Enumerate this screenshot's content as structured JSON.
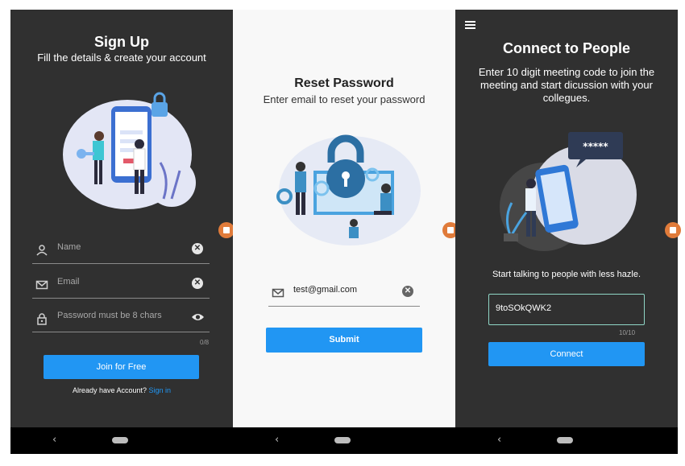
{
  "signup": {
    "title": "Sign Up",
    "subtitle": "Fill the details & create your account",
    "name_placeholder": "Name",
    "email_placeholder": "Email",
    "password_placeholder": "Password must be 8 chars",
    "password_counter": "0/8",
    "join_button": "Join for Free",
    "account_prompt": "Already have Account?",
    "sign_in_link": "Sign in"
  },
  "reset": {
    "title": "Reset Password",
    "subtitle": "Enter email to reset your password",
    "email_value": "test@gmail.com",
    "submit_button": "Submit"
  },
  "connect": {
    "title": "Connect to People",
    "description": "Enter 10 digit meeting code to join the meeting and start dicussion with your collegues.",
    "password_bubble": "*****",
    "prompt": "Start talking to people with less hazle.",
    "code_value": "9toSOkQWK2",
    "code_counter": "10/10",
    "connect_button": "Connect"
  },
  "nav": {
    "back_glyph": "‹"
  },
  "icons": [
    "person-icon",
    "mail-icon",
    "lock-icon",
    "clear-icon",
    "eye-icon",
    "hamburger-menu-icon"
  ],
  "colors": {
    "accent": "#2196f3",
    "dark_bg": "#303030",
    "light_bg": "#f8f8f8",
    "input_border_active": "#8fd6c6",
    "side_tab": "#e07b3a"
  }
}
